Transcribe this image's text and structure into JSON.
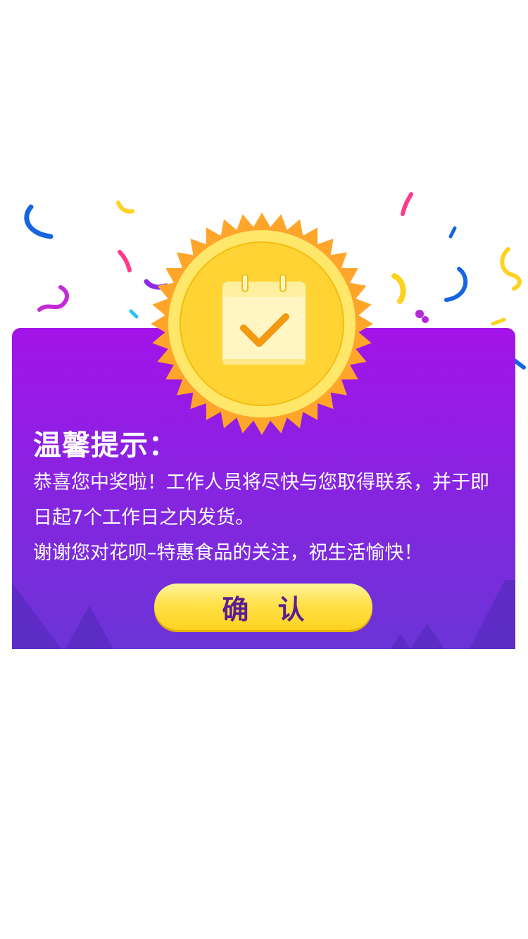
{
  "dialog": {
    "title": "温馨提示：",
    "message_line1": "恭喜您中奖啦！工作人员将尽快与您取得联系，并于即日起7个工作日之内发货。",
    "message_line2": "谢谢您对花呗–特惠食品的关注，祝生活愉快！",
    "confirm_label": "确 认"
  },
  "colors": {
    "card_top": "#a313e9",
    "card_bottom": "#6b34d6",
    "button": "#ffd21f",
    "button_text": "#5b1e92",
    "badge_gold": "#ffd333"
  },
  "icons": {
    "badge": "calendar-check-icon",
    "confetti": "confetti-decoration"
  }
}
